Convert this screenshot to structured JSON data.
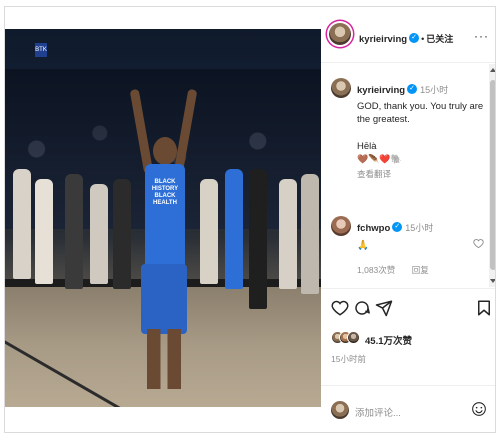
{
  "post": {
    "author": {
      "username": "kyrieirving",
      "follow_label": "已关注",
      "more_label": "···"
    },
    "caption": {
      "username": "kyrieirving",
      "time": "15小时",
      "text": "GOD, thank you. You truly are the greatest.",
      "signoff": "Hēlà",
      "emojis": "🤎🪶❤️🐘",
      "translate_label": "查看翻译"
    },
    "comment": {
      "username": "fchwpo",
      "time": "15小时",
      "text": "🙏",
      "likes_count": "1,083次赞",
      "reply_label": "回复"
    },
    "likes_text": "45.1万次赞",
    "post_time": "15小时前",
    "add_comment_placeholder": "添加评论...",
    "jersey_text": "BLACK HISTORY BLACK HEALTH",
    "photo_sign": "BTK"
  },
  "icons": {
    "like": "heart-icon",
    "comment": "comment-icon",
    "share": "share-icon",
    "save": "bookmark-icon",
    "emoji": "emoji-icon",
    "comment_like": "heart-icon"
  },
  "colors": {
    "verified": "#0095f6",
    "story_ring": "#d6249f",
    "jersey": "#2d6fd6"
  }
}
